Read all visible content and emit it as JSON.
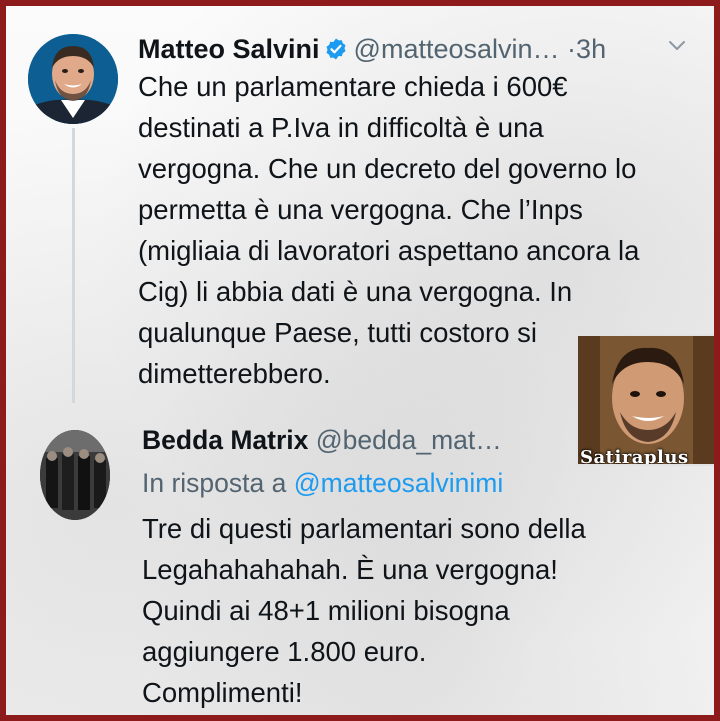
{
  "main_tweet": {
    "name": "Matteo Salvini",
    "handle": "@matteosalvin…",
    "separator": "·",
    "time": "3h",
    "text_lines": [
      "Che un parlamentare chieda i 600€",
      "destinati a P.Iva in difficoltà è una",
      "vergogna. Che un decreto del governo lo",
      "permetta è una vergogna. Che l’Inps",
      "(migliaia di lavoratori aspettano ancora la",
      "Cig) li abbia dati è una vergogna. In",
      "qualunque Paese, tutti costoro si",
      "dimetterebbero."
    ]
  },
  "overlay": {
    "caption": "Satiraplus"
  },
  "reply_tweet": {
    "name": "Bedda Matrix",
    "handle": "@bedda_mat…",
    "reply_prefix": "In risposta a",
    "reply_mention": "@matteosalvinimi",
    "text_lines": [
      "Tre di questi parlamentari sono della",
      "Legahahahahah. È una vergogna!",
      "Quindi ai  48+1 milioni bisogna",
      "aggiungere 1.800 euro.",
      "Complimenti!"
    ]
  },
  "colors": {
    "frame": "#8e1b1b",
    "verified": "#1d9bf0",
    "mention": "#1d9bf0",
    "secondary_text": "#536471"
  },
  "icons": [
    "verified-badge-icon",
    "chevron-down-icon"
  ]
}
